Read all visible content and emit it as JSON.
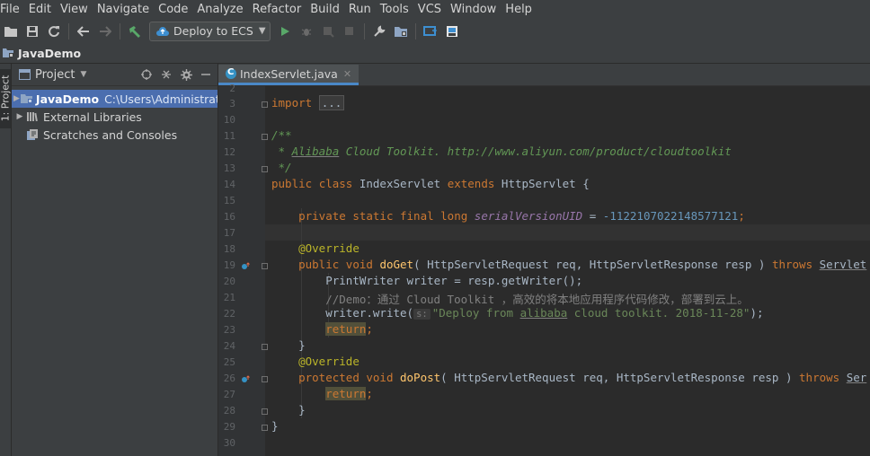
{
  "menu": [
    "File",
    "Edit",
    "View",
    "Navigate",
    "Code",
    "Analyze",
    "Refactor",
    "Build",
    "Run",
    "Tools",
    "VCS",
    "Window",
    "Help"
  ],
  "toolbar": {
    "run_config_label": "Deploy to ECS"
  },
  "navbar": {
    "crumb": "JavaDemo"
  },
  "sidebar_tab": "1: Project",
  "project": {
    "title": "Project",
    "tree": [
      {
        "name": "JavaDemo",
        "path": "C:\\Users\\Administrator",
        "selected": true
      },
      {
        "name": "External Libraries",
        "path": ""
      },
      {
        "name": "Scratches and Consoles",
        "path": ""
      }
    ]
  },
  "editor": {
    "tab_name": "IndexServlet.java",
    "gutter_numbers": [
      "2",
      "3",
      "10",
      "11",
      "12",
      "13",
      "14",
      "15",
      "16",
      "17",
      "18",
      "19",
      "20",
      "21",
      "22",
      "23",
      "24",
      "25",
      "26",
      "27",
      "28",
      "29",
      "30"
    ],
    "lines": {
      "l3_import": "import",
      "l3_fold": "...",
      "l11": "/**",
      "l12_star": " * ",
      "l12_alibaba": "Alibaba",
      "l12_rest": " Cloud Toolkit. http://www.aliyun.com/product/cloudtoolkit",
      "l13": " */",
      "l14_public": "public",
      "l14_class": "class",
      "l14_name": "IndexServlet",
      "l14_extends": "extends",
      "l14_super": "HttpServlet {",
      "l16_mods": "private static final long",
      "l16_field": "serialVersionUID",
      "l16_eq": " = ",
      "l16_num": "-1122107022148577121",
      "l16_end": ";",
      "l18_ann": "@Override",
      "l19_mods": "public void",
      "l19_name": "doGet",
      "l19_params": "( HttpServletRequest req, HttpServletResponse resp ) ",
      "l19_throws": "throws",
      "l19_exc": "Servlet",
      "l20": "PrintWriter writer = resp.getWriter();",
      "l21": "//Demo：通过 Cloud Toolkit ，高效的将本地应用程序代码修改，部署到云上。",
      "l22_call": "writer.write(",
      "l22_hint": "s:",
      "l22_str1": "\"Deploy from ",
      "l22_alibaba": "alibaba",
      "l22_str2": " cloud toolkit. 2018-11-28\"",
      "l22_end": ");",
      "l23_return": "return",
      "l23_end": ";",
      "l24": "}",
      "l25_ann": "@Override",
      "l26_mods": "protected void",
      "l26_name": "doPost",
      "l26_params": "( HttpServletRequest req, HttpServletResponse resp ) ",
      "l26_throws": "throws",
      "l26_exc": "Ser",
      "l27_return": "return",
      "l27_end": ";",
      "l28": "}",
      "l29": "}"
    }
  }
}
